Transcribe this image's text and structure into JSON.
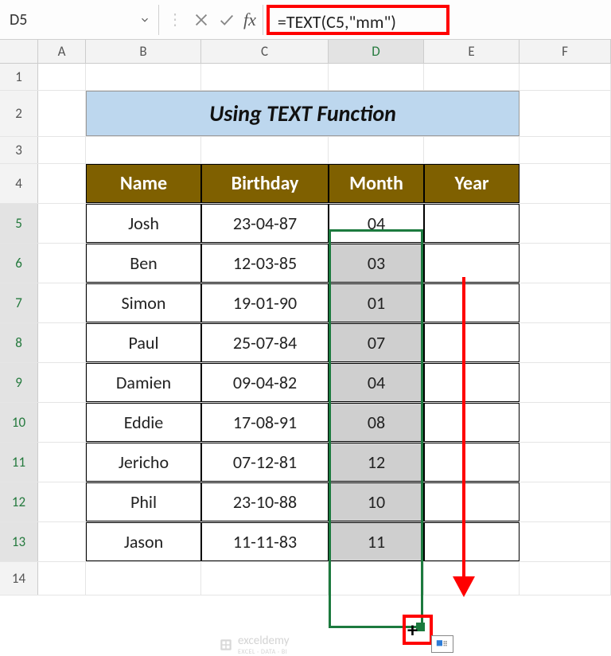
{
  "name_box": "D5",
  "formula": "=TEXT(C5,\"mm\")",
  "fx_label": "fx",
  "columns": [
    "A",
    "B",
    "C",
    "D",
    "E",
    "F"
  ],
  "row_nums": [
    "1",
    "2",
    "3",
    "4",
    "5",
    "6",
    "7",
    "8",
    "9",
    "10",
    "11",
    "12",
    "13",
    "14"
  ],
  "title": "Using TEXT Function",
  "headers": {
    "name": "Name",
    "birthday": "Birthday",
    "month": "Month",
    "year": "Year"
  },
  "rows": [
    {
      "name": "Josh",
      "birthday": "23-04-87",
      "month": "04"
    },
    {
      "name": "Ben",
      "birthday": "12-03-85",
      "month": "03"
    },
    {
      "name": "Simon",
      "birthday": "19-01-90",
      "month": "01"
    },
    {
      "name": "Paul",
      "birthday": "25-07-84",
      "month": "07"
    },
    {
      "name": "Damien",
      "birthday": "09-04-82",
      "month": "04"
    },
    {
      "name": "Eddie",
      "birthday": "17-08-91",
      "month": "08"
    },
    {
      "name": "Jericho",
      "birthday": "07-12-81",
      "month": "12"
    },
    {
      "name": "Phil",
      "birthday": "23-10-88",
      "month": "10"
    },
    {
      "name": "Jason",
      "birthday": "11-11-83",
      "month": "11"
    }
  ],
  "watermark": {
    "brand": "exceldemy",
    "tag": "EXCEL · DATA · BI"
  }
}
